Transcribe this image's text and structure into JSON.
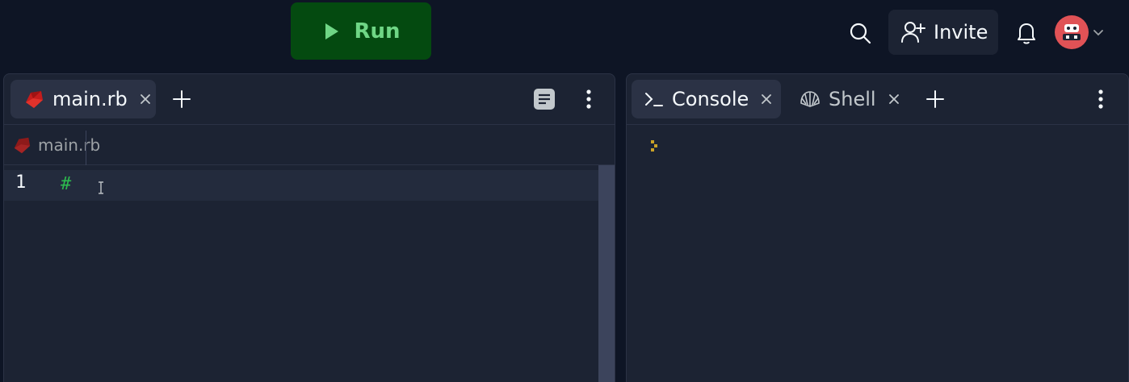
{
  "toolbar": {
    "run_label": "Run",
    "invite_label": "Invite"
  },
  "editor_panel": {
    "tabs": [
      {
        "label": "main.rb",
        "icon": "ruby-icon",
        "active": true
      }
    ],
    "breadcrumb": {
      "label": "main.rb",
      "icon": "ruby-icon"
    },
    "lines": [
      {
        "number": "1",
        "text": "#"
      }
    ]
  },
  "console_panel": {
    "tabs": [
      {
        "label": "Console",
        "icon": "terminal-prompt-icon",
        "active": true
      },
      {
        "label": "Shell",
        "icon": "shell-icon",
        "active": false
      }
    ]
  },
  "colors": {
    "background": "#0e1525",
    "panel": "#1c2333",
    "run_button": "#044a10",
    "run_text": "#6fd685",
    "code_comment": "#2dba4e",
    "avatar": "#e05256"
  }
}
